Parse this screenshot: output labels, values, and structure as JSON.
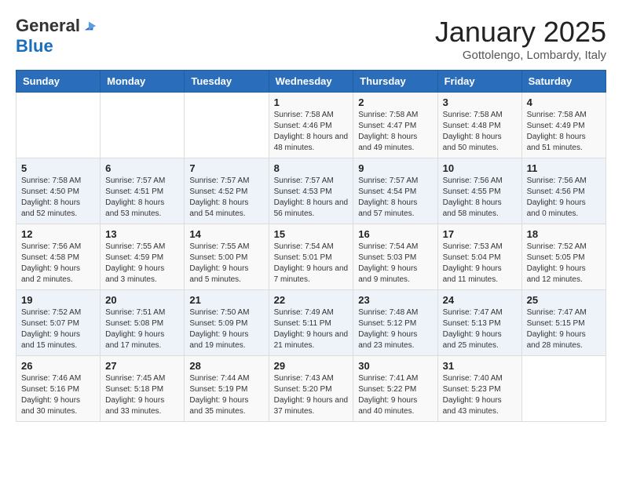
{
  "logo": {
    "general": "General",
    "blue": "Blue"
  },
  "title": "January 2025",
  "subtitle": "Gottolengo, Lombardy, Italy",
  "weekdays": [
    "Sunday",
    "Monday",
    "Tuesday",
    "Wednesday",
    "Thursday",
    "Friday",
    "Saturday"
  ],
  "weeks": [
    [
      {
        "day": "",
        "sunrise": "",
        "sunset": "",
        "daylight": ""
      },
      {
        "day": "",
        "sunrise": "",
        "sunset": "",
        "daylight": ""
      },
      {
        "day": "",
        "sunrise": "",
        "sunset": "",
        "daylight": ""
      },
      {
        "day": "1",
        "sunrise": "Sunrise: 7:58 AM",
        "sunset": "Sunset: 4:46 PM",
        "daylight": "Daylight: 8 hours and 48 minutes."
      },
      {
        "day": "2",
        "sunrise": "Sunrise: 7:58 AM",
        "sunset": "Sunset: 4:47 PM",
        "daylight": "Daylight: 8 hours and 49 minutes."
      },
      {
        "day": "3",
        "sunrise": "Sunrise: 7:58 AM",
        "sunset": "Sunset: 4:48 PM",
        "daylight": "Daylight: 8 hours and 50 minutes."
      },
      {
        "day": "4",
        "sunrise": "Sunrise: 7:58 AM",
        "sunset": "Sunset: 4:49 PM",
        "daylight": "Daylight: 8 hours and 51 minutes."
      }
    ],
    [
      {
        "day": "5",
        "sunrise": "Sunrise: 7:58 AM",
        "sunset": "Sunset: 4:50 PM",
        "daylight": "Daylight: 8 hours and 52 minutes."
      },
      {
        "day": "6",
        "sunrise": "Sunrise: 7:57 AM",
        "sunset": "Sunset: 4:51 PM",
        "daylight": "Daylight: 8 hours and 53 minutes."
      },
      {
        "day": "7",
        "sunrise": "Sunrise: 7:57 AM",
        "sunset": "Sunset: 4:52 PM",
        "daylight": "Daylight: 8 hours and 54 minutes."
      },
      {
        "day": "8",
        "sunrise": "Sunrise: 7:57 AM",
        "sunset": "Sunset: 4:53 PM",
        "daylight": "Daylight: 8 hours and 56 minutes."
      },
      {
        "day": "9",
        "sunrise": "Sunrise: 7:57 AM",
        "sunset": "Sunset: 4:54 PM",
        "daylight": "Daylight: 8 hours and 57 minutes."
      },
      {
        "day": "10",
        "sunrise": "Sunrise: 7:56 AM",
        "sunset": "Sunset: 4:55 PM",
        "daylight": "Daylight: 8 hours and 58 minutes."
      },
      {
        "day": "11",
        "sunrise": "Sunrise: 7:56 AM",
        "sunset": "Sunset: 4:56 PM",
        "daylight": "Daylight: 9 hours and 0 minutes."
      }
    ],
    [
      {
        "day": "12",
        "sunrise": "Sunrise: 7:56 AM",
        "sunset": "Sunset: 4:58 PM",
        "daylight": "Daylight: 9 hours and 2 minutes."
      },
      {
        "day": "13",
        "sunrise": "Sunrise: 7:55 AM",
        "sunset": "Sunset: 4:59 PM",
        "daylight": "Daylight: 9 hours and 3 minutes."
      },
      {
        "day": "14",
        "sunrise": "Sunrise: 7:55 AM",
        "sunset": "Sunset: 5:00 PM",
        "daylight": "Daylight: 9 hours and 5 minutes."
      },
      {
        "day": "15",
        "sunrise": "Sunrise: 7:54 AM",
        "sunset": "Sunset: 5:01 PM",
        "daylight": "Daylight: 9 hours and 7 minutes."
      },
      {
        "day": "16",
        "sunrise": "Sunrise: 7:54 AM",
        "sunset": "Sunset: 5:03 PM",
        "daylight": "Daylight: 9 hours and 9 minutes."
      },
      {
        "day": "17",
        "sunrise": "Sunrise: 7:53 AM",
        "sunset": "Sunset: 5:04 PM",
        "daylight": "Daylight: 9 hours and 11 minutes."
      },
      {
        "day": "18",
        "sunrise": "Sunrise: 7:52 AM",
        "sunset": "Sunset: 5:05 PM",
        "daylight": "Daylight: 9 hours and 12 minutes."
      }
    ],
    [
      {
        "day": "19",
        "sunrise": "Sunrise: 7:52 AM",
        "sunset": "Sunset: 5:07 PM",
        "daylight": "Daylight: 9 hours and 15 minutes."
      },
      {
        "day": "20",
        "sunrise": "Sunrise: 7:51 AM",
        "sunset": "Sunset: 5:08 PM",
        "daylight": "Daylight: 9 hours and 17 minutes."
      },
      {
        "day": "21",
        "sunrise": "Sunrise: 7:50 AM",
        "sunset": "Sunset: 5:09 PM",
        "daylight": "Daylight: 9 hours and 19 minutes."
      },
      {
        "day": "22",
        "sunrise": "Sunrise: 7:49 AM",
        "sunset": "Sunset: 5:11 PM",
        "daylight": "Daylight: 9 hours and 21 minutes."
      },
      {
        "day": "23",
        "sunrise": "Sunrise: 7:48 AM",
        "sunset": "Sunset: 5:12 PM",
        "daylight": "Daylight: 9 hours and 23 minutes."
      },
      {
        "day": "24",
        "sunrise": "Sunrise: 7:47 AM",
        "sunset": "Sunset: 5:13 PM",
        "daylight": "Daylight: 9 hours and 25 minutes."
      },
      {
        "day": "25",
        "sunrise": "Sunrise: 7:47 AM",
        "sunset": "Sunset: 5:15 PM",
        "daylight": "Daylight: 9 hours and 28 minutes."
      }
    ],
    [
      {
        "day": "26",
        "sunrise": "Sunrise: 7:46 AM",
        "sunset": "Sunset: 5:16 PM",
        "daylight": "Daylight: 9 hours and 30 minutes."
      },
      {
        "day": "27",
        "sunrise": "Sunrise: 7:45 AM",
        "sunset": "Sunset: 5:18 PM",
        "daylight": "Daylight: 9 hours and 33 minutes."
      },
      {
        "day": "28",
        "sunrise": "Sunrise: 7:44 AM",
        "sunset": "Sunset: 5:19 PM",
        "daylight": "Daylight: 9 hours and 35 minutes."
      },
      {
        "day": "29",
        "sunrise": "Sunrise: 7:43 AM",
        "sunset": "Sunset: 5:20 PM",
        "daylight": "Daylight: 9 hours and 37 minutes."
      },
      {
        "day": "30",
        "sunrise": "Sunrise: 7:41 AM",
        "sunset": "Sunset: 5:22 PM",
        "daylight": "Daylight: 9 hours and 40 minutes."
      },
      {
        "day": "31",
        "sunrise": "Sunrise: 7:40 AM",
        "sunset": "Sunset: 5:23 PM",
        "daylight": "Daylight: 9 hours and 43 minutes."
      },
      {
        "day": "",
        "sunrise": "",
        "sunset": "",
        "daylight": ""
      }
    ]
  ]
}
